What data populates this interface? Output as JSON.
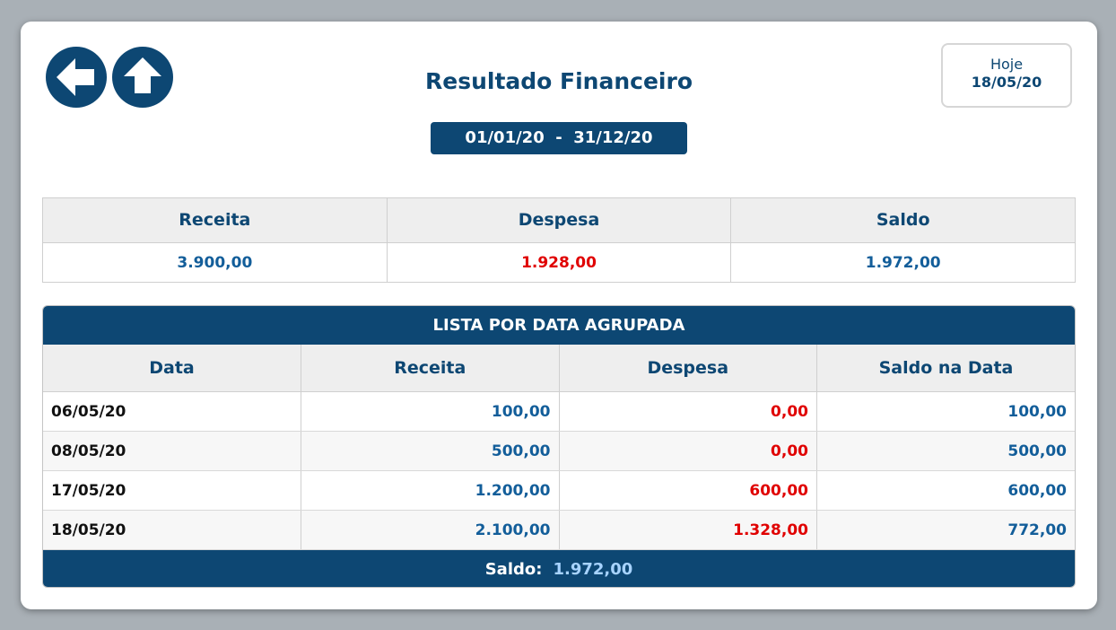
{
  "header": {
    "title": "Resultado Financeiro",
    "period": "01/01/20  -  31/12/20",
    "today_label": "Hoje",
    "today_value": "18/05/20"
  },
  "nav": {
    "back_icon": "arrow-left-icon",
    "home_icon": "arrow-up-icon"
  },
  "summary": {
    "headers": [
      "Receita",
      "Despesa",
      "Saldo"
    ],
    "values": [
      "3.900,00",
      "1.928,00",
      "1.972,00"
    ]
  },
  "list": {
    "caption": "LISTA POR DATA AGRUPADA",
    "columns": [
      "Data",
      "Receita",
      "Despesa",
      "Saldo na Data"
    ],
    "rows": [
      {
        "date": "06/05/20",
        "receita": "100,00",
        "despesa": "0,00",
        "saldo": "100,00"
      },
      {
        "date": "08/05/20",
        "receita": "500,00",
        "despesa": "0,00",
        "saldo": "500,00"
      },
      {
        "date": "17/05/20",
        "receita": "1.200,00",
        "despesa": "600,00",
        "saldo": "600,00"
      },
      {
        "date": "18/05/20",
        "receita": "2.100,00",
        "despesa": "1.328,00",
        "saldo": "772,00"
      }
    ],
    "footer_label": "Saldo:",
    "footer_value": "1.972,00"
  },
  "colors": {
    "primary": "#0d4773",
    "positive": "#135e9a",
    "negative": "#e00000",
    "footer_value": "#a7d3ff"
  }
}
